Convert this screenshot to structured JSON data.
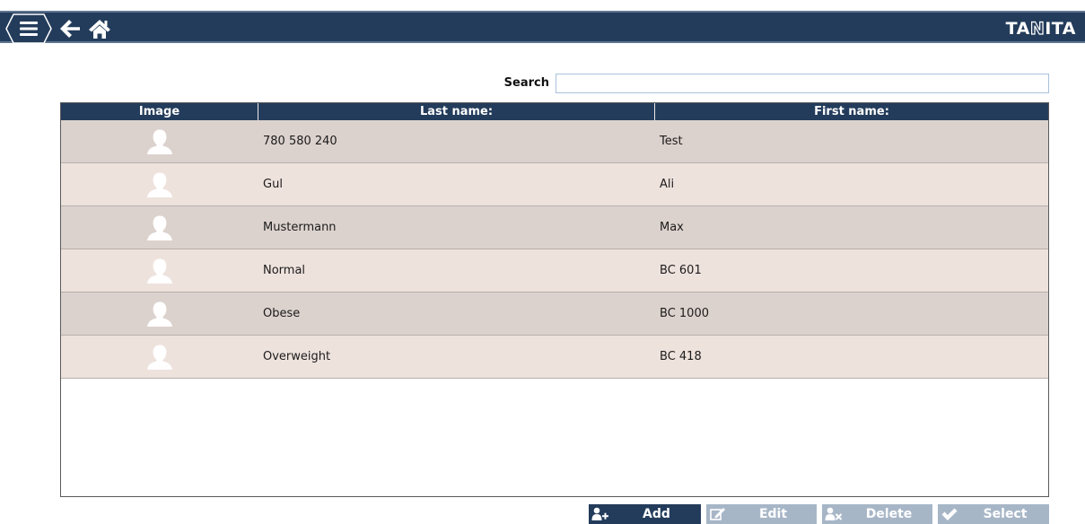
{
  "header": {
    "menu_icon": "hamburger-menu-icon",
    "back_icon": "arrow-left-icon",
    "home_icon": "home-icon",
    "logo_parts": [
      "TA",
      "N",
      "ITA"
    ],
    "bar_color": "#233c5b"
  },
  "search": {
    "label": "Search",
    "value": "",
    "placeholder": ""
  },
  "table": {
    "columns": [
      "Image",
      "Last name:",
      "First name:"
    ],
    "rows": [
      {
        "last_name": "780 580 240",
        "first_name": "Test"
      },
      {
        "last_name": "Gul",
        "first_name": "Ali"
      },
      {
        "last_name": "Mustermann",
        "first_name": "Max"
      },
      {
        "last_name": "Normal",
        "first_name": "BC 601"
      },
      {
        "last_name": "Obese",
        "first_name": "BC 1000"
      },
      {
        "last_name": "Overweight",
        "first_name": "BC 418"
      }
    ],
    "row_colors": [
      "#dcd2cd",
      "#eee2dd"
    ]
  },
  "actions": {
    "add": {
      "label": "Add",
      "icon": "add-user-icon",
      "enabled": true
    },
    "edit": {
      "label": "Edit",
      "icon": "edit-icon",
      "enabled": false
    },
    "delete": {
      "label": "Delete",
      "icon": "delete-user-icon",
      "enabled": false
    },
    "select": {
      "label": "Select",
      "icon": "checkmark-icon",
      "enabled": false
    }
  }
}
